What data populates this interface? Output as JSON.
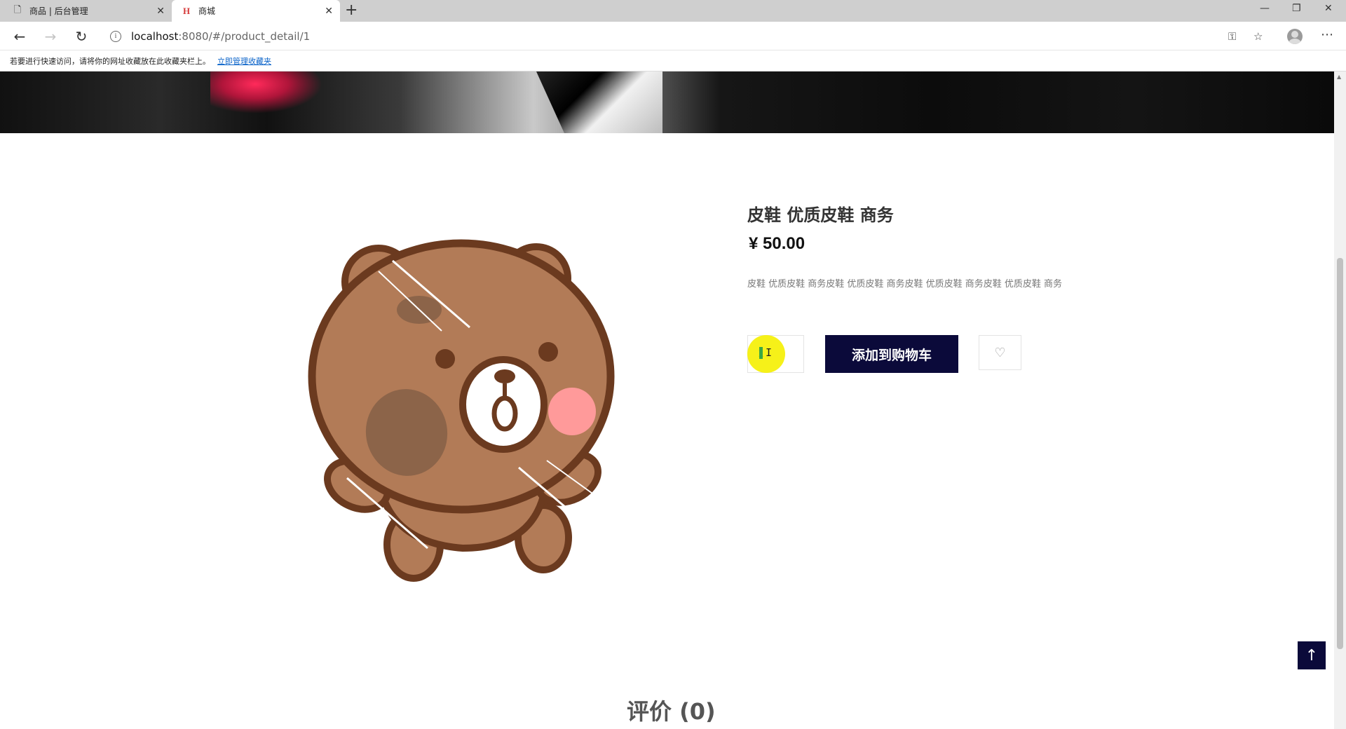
{
  "browser": {
    "tabs": [
      {
        "title": "商品 | 后台管理",
        "icon": "document-icon",
        "active": false
      },
      {
        "title": "商城",
        "icon": "site-h-icon",
        "active": true
      }
    ],
    "new_tab_label": "+",
    "window_controls": {
      "minimize": "—",
      "restore": "❐",
      "close": "✕"
    },
    "url_host": "localhost",
    "url_rest": ":8080/#/product_detail/1",
    "favorites_prompt": "若要进行快速访问，请将你的网址收藏放在此收藏夹栏上。",
    "favorites_link": "立即管理收藏夹"
  },
  "product": {
    "title": "皮鞋 优质皮鞋 商务",
    "price": "¥ 50.00",
    "description": "皮鞋 优质皮鞋 商务皮鞋 优质皮鞋 商务皮鞋 优质皮鞋 商务皮鞋 优质皮鞋 商务",
    "quantity": "1",
    "add_to_cart_label": "添加到购物车",
    "wishlist_icon": "heart-icon"
  },
  "reviews": {
    "title": "评价 (0)"
  },
  "colors": {
    "accent": "#0b0a3a",
    "cursor_highlight": "#f5f000",
    "link": "#0a63c9"
  }
}
